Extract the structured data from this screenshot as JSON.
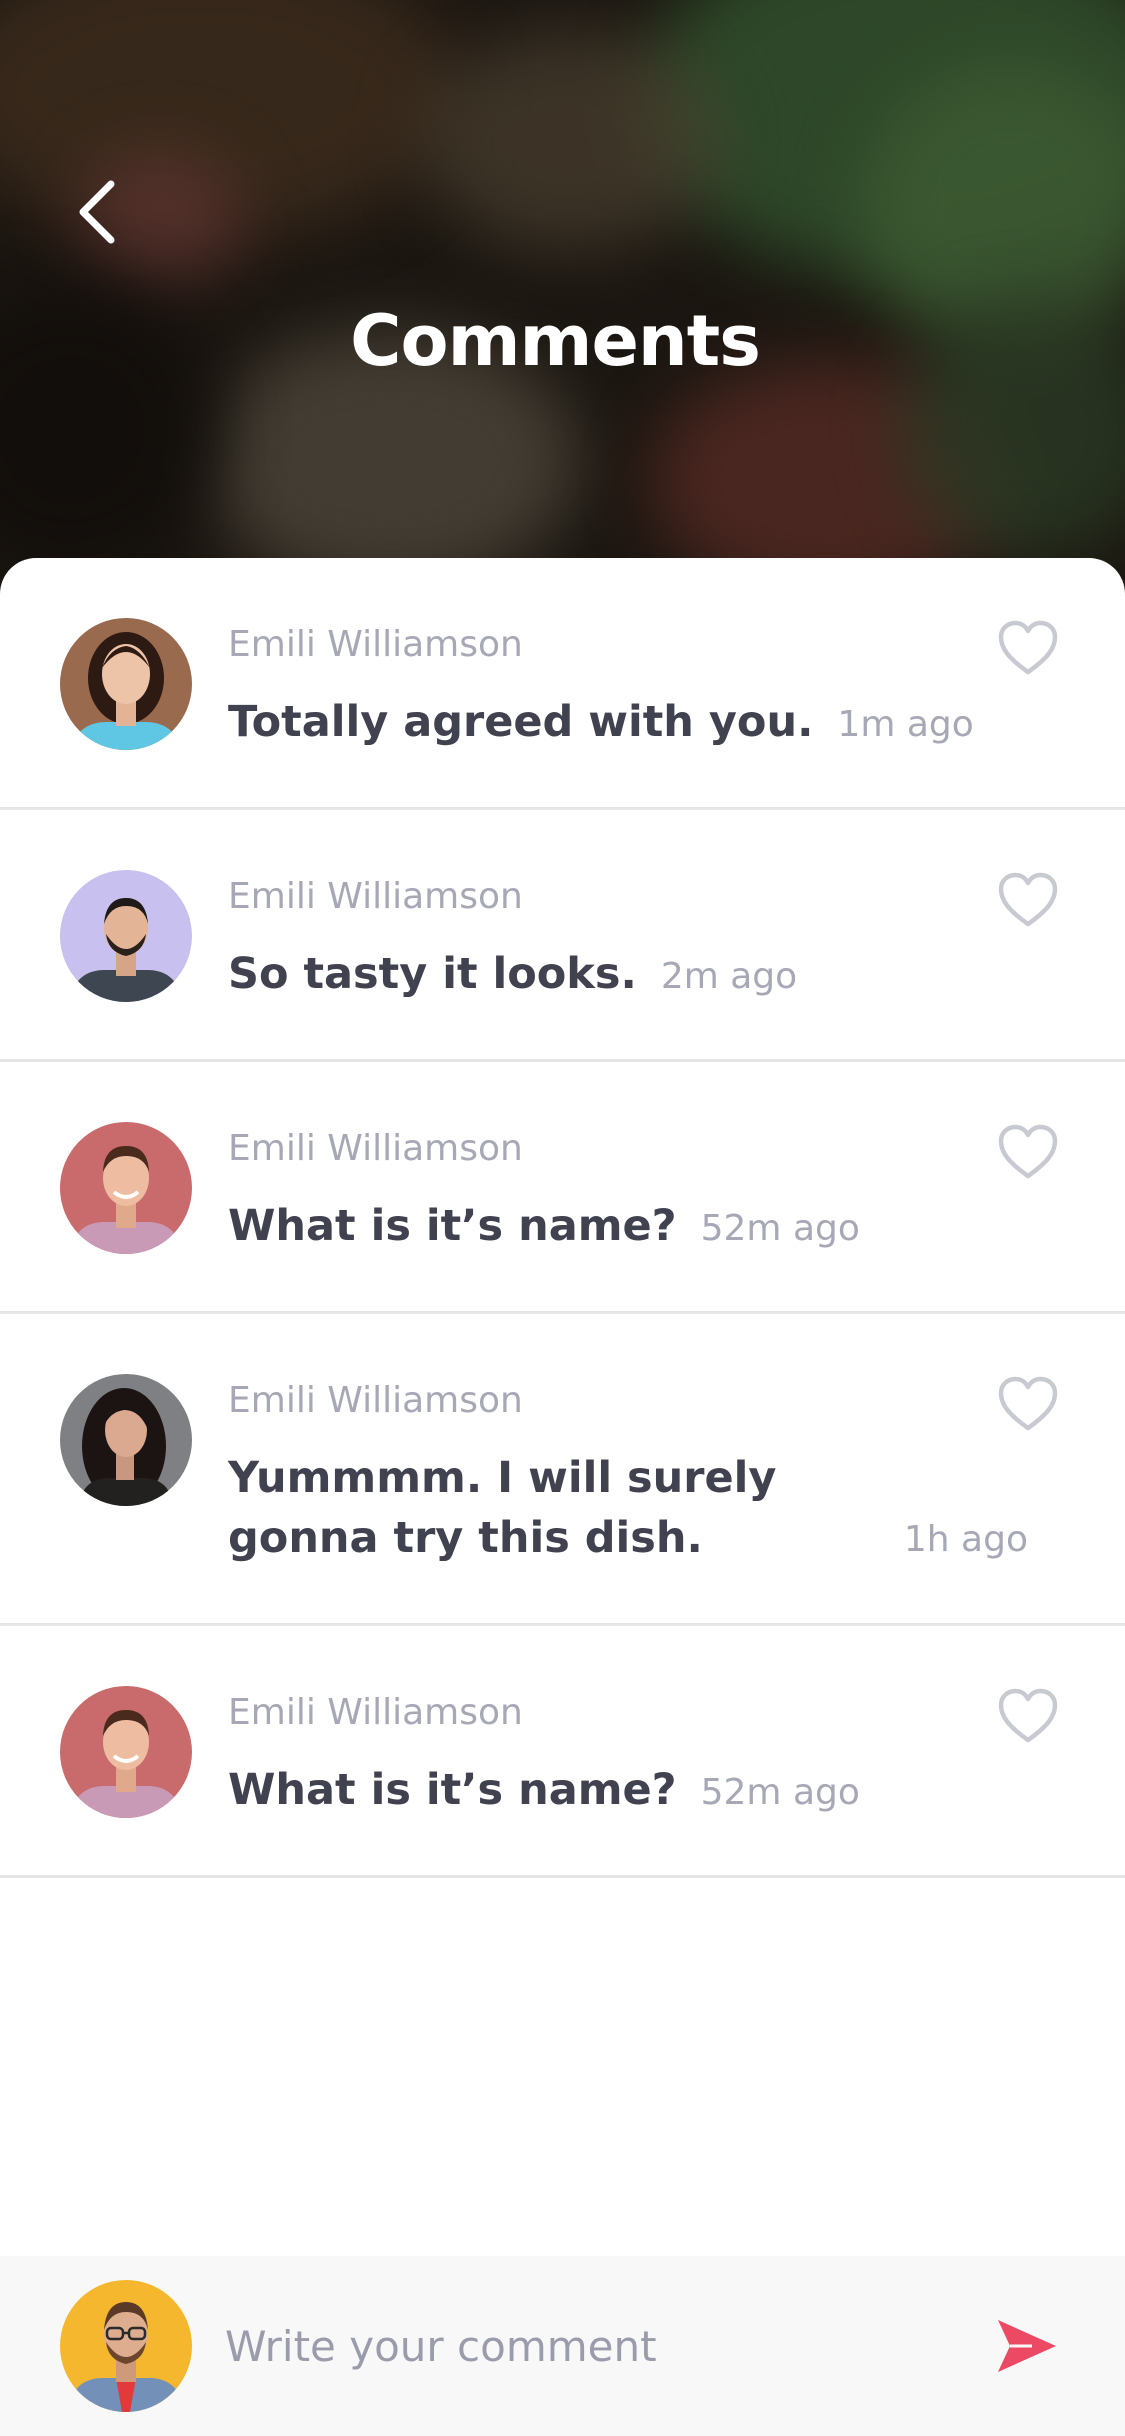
{
  "header": {
    "title": "Comments",
    "back_icon": "chevron-left-icon"
  },
  "comments": [
    {
      "author": "Emili Williamson",
      "text": "Totally agreed with you.",
      "time": "1m ago",
      "avatar": "woman-brunette-blue-shirt"
    },
    {
      "author": "Emili Williamson",
      "text": "So tasty it looks.",
      "time": "2m ago",
      "avatar": "man-beard-lavender-bg"
    },
    {
      "author": "Emili Williamson",
      "text": "What is it’s name?",
      "time": "52m ago",
      "avatar": "man-pink-tee-red-bg"
    },
    {
      "author": "Emili Williamson",
      "text": "Yummmm. I will surely gonna try this dish.",
      "time": "1h ago",
      "avatar": "woman-dark-hair-grey-bg"
    },
    {
      "author": "Emili Williamson",
      "text": "What is it’s name?",
      "time": "52m ago",
      "avatar": "man-pink-tee-red-bg"
    }
  ],
  "composer": {
    "placeholder": "Write your comment",
    "value": "",
    "send_icon": "send-icon",
    "avatar": "man-glasses-yellow-bg"
  },
  "colors": {
    "accent": "#ec4a64",
    "author_text": "#a6a8b5",
    "comment_text": "#41424f",
    "divider": "#e5e5e7",
    "heart_outline": "#c8cad2"
  }
}
